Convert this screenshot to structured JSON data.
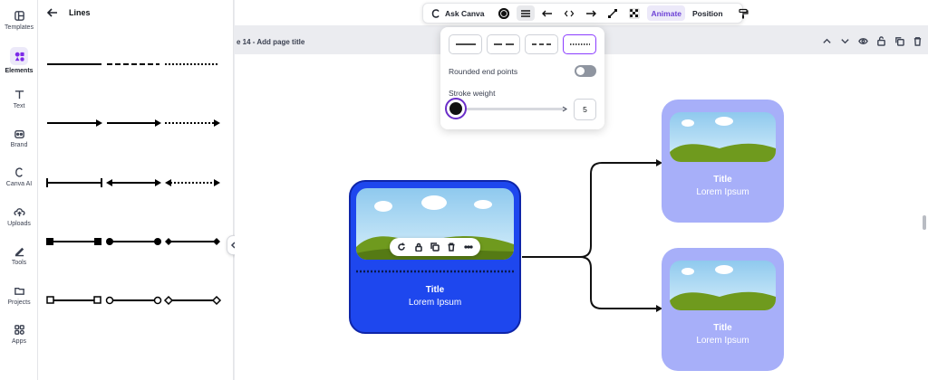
{
  "rail": {
    "items": [
      {
        "label": "Templates",
        "icon": "templates-icon"
      },
      {
        "label": "Elements",
        "icon": "elements-icon",
        "active": true
      },
      {
        "label": "Text",
        "icon": "text-icon"
      },
      {
        "label": "Brand",
        "icon": "brand-icon"
      },
      {
        "label": "Canva AI",
        "icon": "canva-ai-icon"
      },
      {
        "label": "Uploads",
        "icon": "uploads-icon"
      },
      {
        "label": "Tools",
        "icon": "tools-icon"
      },
      {
        "label": "Projects",
        "icon": "projects-icon"
      },
      {
        "label": "Apps",
        "icon": "apps-icon"
      }
    ]
  },
  "panel": {
    "title": "Lines",
    "rows": [
      [
        "solid",
        "dashed",
        "dotted"
      ],
      [
        "solid-arrow",
        "dashed-arrow",
        "dotted-arrow"
      ],
      [
        "bar-end",
        "double-arrow",
        "dotted-double-arrow"
      ],
      [
        "square-end",
        "circle-end",
        "diamond-end"
      ],
      [
        "hollow-square-end",
        "hollow-circle-end",
        "hollow-diamond-end"
      ]
    ]
  },
  "toolbar": {
    "ask_label": "Ask Canva",
    "animate_label": "Animate",
    "position_label": "Position"
  },
  "page": {
    "number_label": "e 14",
    "separator": " - ",
    "title_placeholder": "Add page title"
  },
  "popover": {
    "rounded_label": "Rounded end points",
    "rounded_on": false,
    "stroke_label": "Stroke weight",
    "stroke_value": "5",
    "stroke_fraction": 0.04,
    "styles": [
      "solid",
      "long-dash",
      "short-dash",
      "dotted"
    ],
    "selected_style": "dotted"
  },
  "cards": {
    "main": {
      "title": "Title",
      "subtitle": "Lorem Ipsum"
    },
    "top": {
      "title": "Title",
      "subtitle": "Lorem Ipsum"
    },
    "bottom": {
      "title": "Title",
      "subtitle": "Lorem Ipsum"
    }
  },
  "colors": {
    "accent": "#8b3dff",
    "card_main": "#1e47ee",
    "card_side": "#a7aff9",
    "grass": "#6f9a1e"
  }
}
